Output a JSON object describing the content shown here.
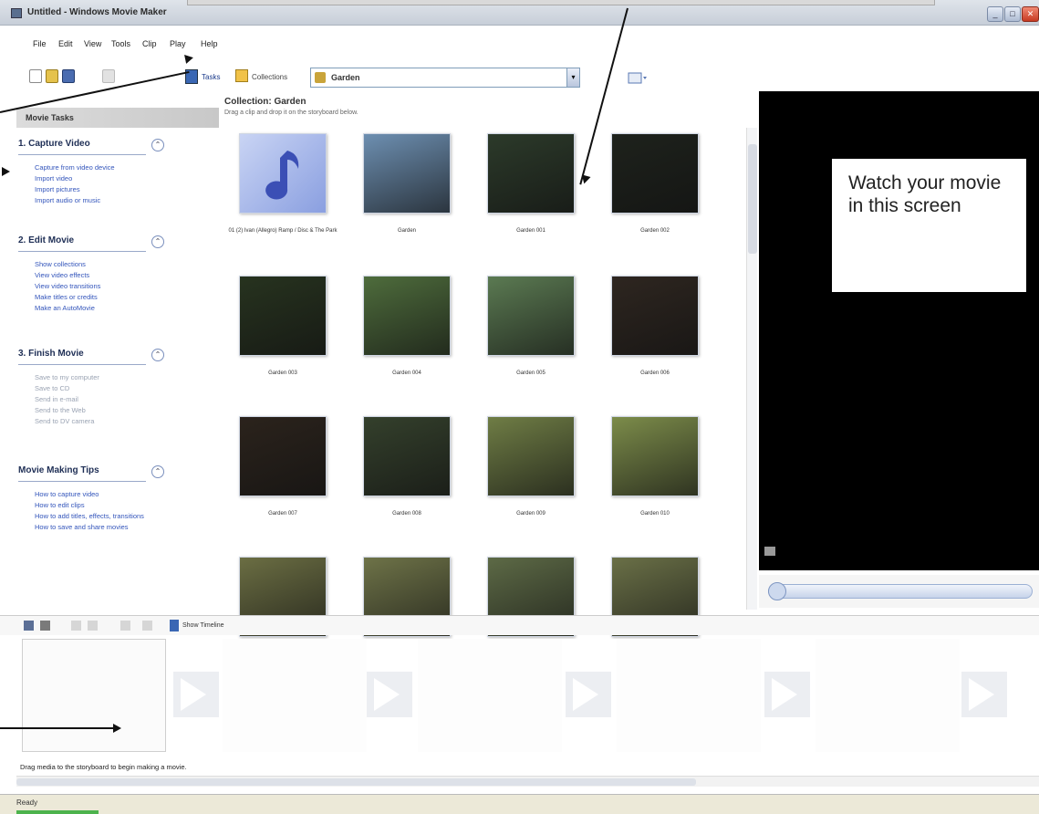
{
  "window": {
    "title": "Untitled - Windows Movie Maker",
    "controls": {
      "minimize": "_",
      "maximize": "□",
      "close": "✕"
    }
  },
  "menu": [
    "File",
    "Edit",
    "View",
    "Tools",
    "Clip",
    "Play",
    "Help"
  ],
  "toolbar": {
    "tasks_label": "Tasks",
    "collections_label": "Collections",
    "collection_selected": "Garden",
    "dropdown_arrow": "▾"
  },
  "taskpane": {
    "header": "Movie Tasks",
    "sections": [
      {
        "title": "1. Capture Video",
        "toggle": "⌃",
        "links": [
          "Capture from video device",
          "Import video",
          "Import pictures",
          "Import audio or music"
        ]
      },
      {
        "title": "2. Edit Movie",
        "toggle": "⌃",
        "links": [
          "Show collections",
          "View video effects",
          "View video transitions",
          "Make titles or credits",
          "Make an AutoMovie"
        ]
      },
      {
        "title": "3. Finish Movie",
        "toggle": "⌃",
        "links": [
          "Save to my computer",
          "Save to CD",
          "Send in e-mail",
          "Send to the Web",
          "Send to DV camera"
        ]
      },
      {
        "title": "Movie Making Tips",
        "toggle": "⌃",
        "links": [
          "How to capture video",
          "How to edit clips",
          "How to add titles, effects, transitions",
          "How to save and share movies"
        ]
      }
    ]
  },
  "collection": {
    "title": "Collection: Garden",
    "hint": "Drag a clip and drop it on the storyboard below.",
    "clips": [
      {
        "caption": "01 (2) Ivan (Allegro) Ramp / Disc & The Park",
        "color": "#8a9fe0",
        "kind": "audio"
      },
      {
        "caption": "Garden",
        "color": "#6d8fb1",
        "kind": "video"
      },
      {
        "caption": "Garden 001",
        "color": "#2c3a2a",
        "kind": "video"
      },
      {
        "caption": "Garden 002",
        "color": "#1e221c",
        "kind": "video"
      },
      {
        "caption": "Garden 003",
        "color": "#27331f",
        "kind": "video"
      },
      {
        "caption": "Garden 004",
        "color": "#4e6c3c",
        "kind": "video"
      },
      {
        "caption": "Garden 005",
        "color": "#5b7a52",
        "kind": "video"
      },
      {
        "caption": "Garden 006",
        "color": "#2e2620",
        "kind": "video"
      },
      {
        "caption": "Garden 007",
        "color": "#2b231c",
        "kind": "video"
      },
      {
        "caption": "Garden 008",
        "color": "#34402c",
        "kind": "video"
      },
      {
        "caption": "Garden 009",
        "color": "#6f7d45",
        "kind": "video"
      },
      {
        "caption": "Garden 010",
        "color": "#7c8c4a",
        "kind": "video"
      },
      {
        "caption": "",
        "color": "#6b6e43",
        "kind": "video"
      },
      {
        "caption": "",
        "color": "#6e7348",
        "kind": "video"
      },
      {
        "caption": "",
        "color": "#5d6a46",
        "kind": "video"
      },
      {
        "caption": "",
        "color": "#6a7047",
        "kind": "video"
      }
    ]
  },
  "monitor": {
    "text": "Watch your movie in this screen"
  },
  "storyboard": {
    "show_timeline_label": "Show Timeline",
    "hint": "Drag media to the storyboard to begin making a movie."
  },
  "status": {
    "text": "Ready"
  },
  "colors": {
    "link": "#3355bb",
    "section_title": "#1e2e55",
    "monitor_bg": "#000000"
  }
}
